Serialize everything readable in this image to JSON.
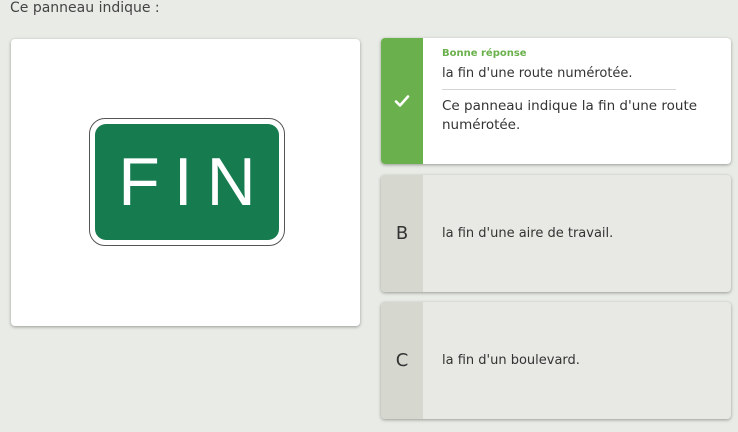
{
  "question": "Ce panneau indique :",
  "sign": {
    "text": "FIN",
    "color": "#177b50"
  },
  "answers": [
    {
      "letter": "",
      "text": "la fin d'une route numérotée.",
      "correct": true,
      "correct_label": "Bonne réponse",
      "explanation": "Ce panneau indique la fin d'une route numérotée."
    },
    {
      "letter": "B",
      "text": "la fin d'une aire de travail.",
      "correct": false
    },
    {
      "letter": "C",
      "text": "la fin d'un boulevard.",
      "correct": false
    }
  ],
  "colors": {
    "correct": "#6ab04c",
    "option_bg": "#e8e9e4"
  }
}
